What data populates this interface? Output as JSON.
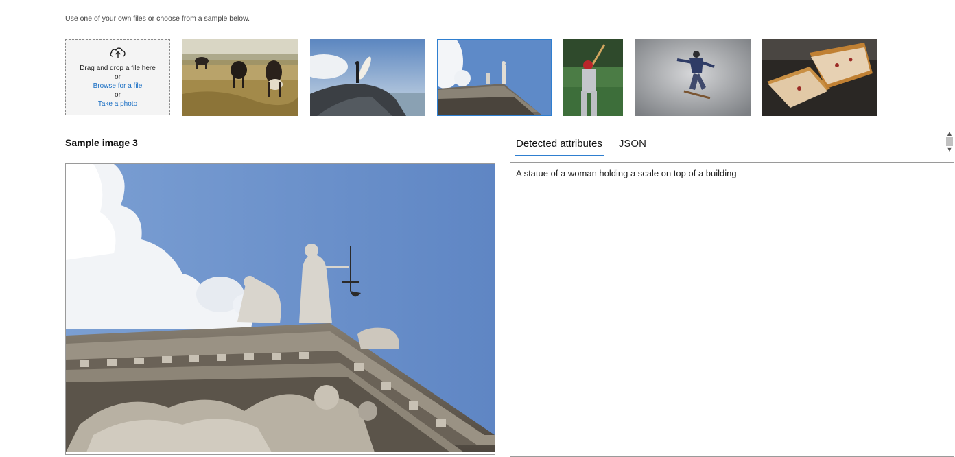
{
  "intro_text": "Use one of your own files or choose from a sample below.",
  "upload": {
    "drag_text": "Drag and drop a file here",
    "or1": "or",
    "browse_label": "Browse for a file",
    "or2": "or",
    "photo_label": "Take a photo"
  },
  "samples": [
    {
      "id": "cows",
      "selected": false
    },
    {
      "id": "surfer",
      "selected": false
    },
    {
      "id": "statue-building",
      "selected": true
    },
    {
      "id": "baseball-batter",
      "selected": false
    },
    {
      "id": "skateboarder",
      "selected": false
    },
    {
      "id": "grilled-sandwich",
      "selected": false
    }
  ],
  "sample_title": "Sample image 3",
  "tabs": [
    {
      "label": "Detected attributes",
      "active": true
    },
    {
      "label": "JSON",
      "active": false
    }
  ],
  "results": {
    "caption": "A statue of a woman holding a scale on top of a building"
  },
  "colors": {
    "accent": "#2f7fd0",
    "link": "#1a6fc4"
  }
}
